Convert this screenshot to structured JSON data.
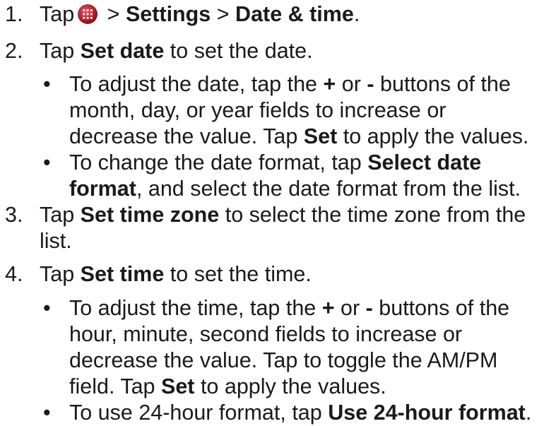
{
  "steps": [
    {
      "number": "1.",
      "pre": "Tap",
      "icon": "apps-grid-icon",
      "sep1": " > ",
      "settings": "Settings",
      "sep2": " > ",
      "date_time": "Date & time",
      "end": "."
    },
    {
      "number": "2.",
      "pre": "Tap ",
      "bold": "Set date",
      "post": " to set the date.",
      "bullets": [
        {
          "dot": "•",
          "line1_a": "To adjust the date, tap the ",
          "line1_plus": "+",
          "line1_b": " or ",
          "line1_minus": "-",
          "line1_c": " buttons of the",
          "line2": "month, day, or year fields to increase or",
          "line3_a": "decrease the value. Tap ",
          "line3_bold": "Set",
          "line3_b": " to apply the values."
        },
        {
          "dot": "•",
          "line1_a": "To change the date format, tap ",
          "line1_bold": "Select date",
          "line2_bold": "format",
          "line2_b": ", and select the date format from the list."
        }
      ]
    },
    {
      "number": "3.",
      "pre": "Tap ",
      "bold": "Set time zone",
      "post": " to select the time zone from the",
      "line2": "list."
    },
    {
      "number": "4.",
      "pre": "Tap ",
      "bold": "Set time",
      "post": " to set the time.",
      "bullets": [
        {
          "dot": "•",
          "line1_a": "To adjust the time, tap the ",
          "line1_plus": "+",
          "line1_b": " or ",
          "line1_minus": "-",
          "line1_c": " buttons of the",
          "line2": "hour, minute, second fields to increase or",
          "line3": "decrease the value. Tap to toggle the AM/PM",
          "line4_a": "field. Tap ",
          "line4_bold": "Set",
          "line4_b": " to apply the values."
        },
        {
          "dot": "•",
          "line1_a": "To use 24-hour format, tap ",
          "line1_bold": "Use 24-hour format",
          "line1_b": "."
        }
      ]
    }
  ],
  "colors": {
    "text": "#1a1a1a",
    "icon_red": "#b3242c",
    "icon_dark": "#6e1016"
  }
}
